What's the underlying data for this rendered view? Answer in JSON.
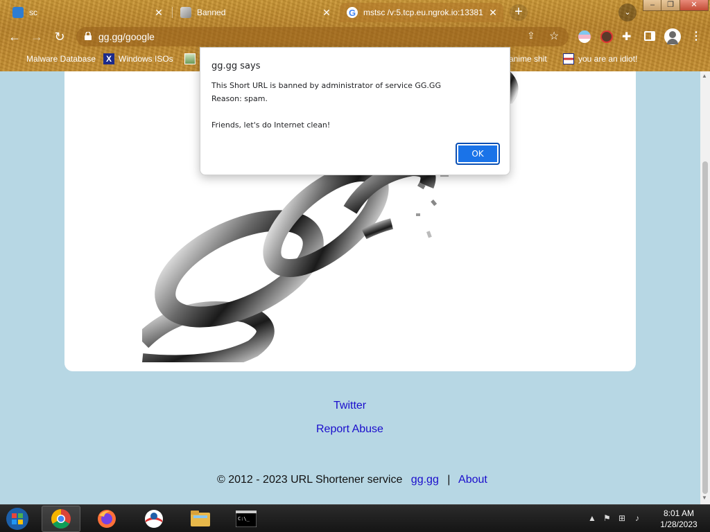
{
  "browser": {
    "tabs": [
      {
        "title": "sc",
        "active": false
      },
      {
        "title": "Banned",
        "active": false
      },
      {
        "title": "mstsc /v:5.tcp.eu.ngrok.io:13381",
        "active": true
      }
    ],
    "new_tab_symbol": "+",
    "url": "gg.gg/google",
    "bookmarks": [
      {
        "label": "Malware Database"
      },
      {
        "label": "Windows ISOs"
      },
      {
        "label": "anime shit"
      },
      {
        "label": "you are an idiot!"
      }
    ],
    "window_controls": {
      "minimize": "–",
      "maximize": "❐",
      "close": "✕"
    }
  },
  "page": {
    "footer_links": {
      "twitter": "Twitter",
      "report_abuse": "Report Abuse"
    },
    "copyright": {
      "text": "© 2012 - 2023 URL Shortener service",
      "site_link": "gg.gg",
      "separator": "|",
      "about_link": "About"
    }
  },
  "dialog": {
    "title": "gg.gg says",
    "line1": "This Short URL is banned by administrator of service GG.GG",
    "line2": "Reason: spam.",
    "line3": "Friends, let's do Internet clean!",
    "ok_label": "OK"
  },
  "taskbar": {
    "time": "8:01 AM",
    "date": "1/28/2023",
    "apps": [
      "start-orb",
      "chrome",
      "firefox",
      "internet-explorer",
      "file-explorer",
      "command-prompt"
    ]
  },
  "colors": {
    "page_background": "#b7d7e4",
    "link": "#1a0dcc",
    "dialog_ok": "#1a73e8"
  }
}
